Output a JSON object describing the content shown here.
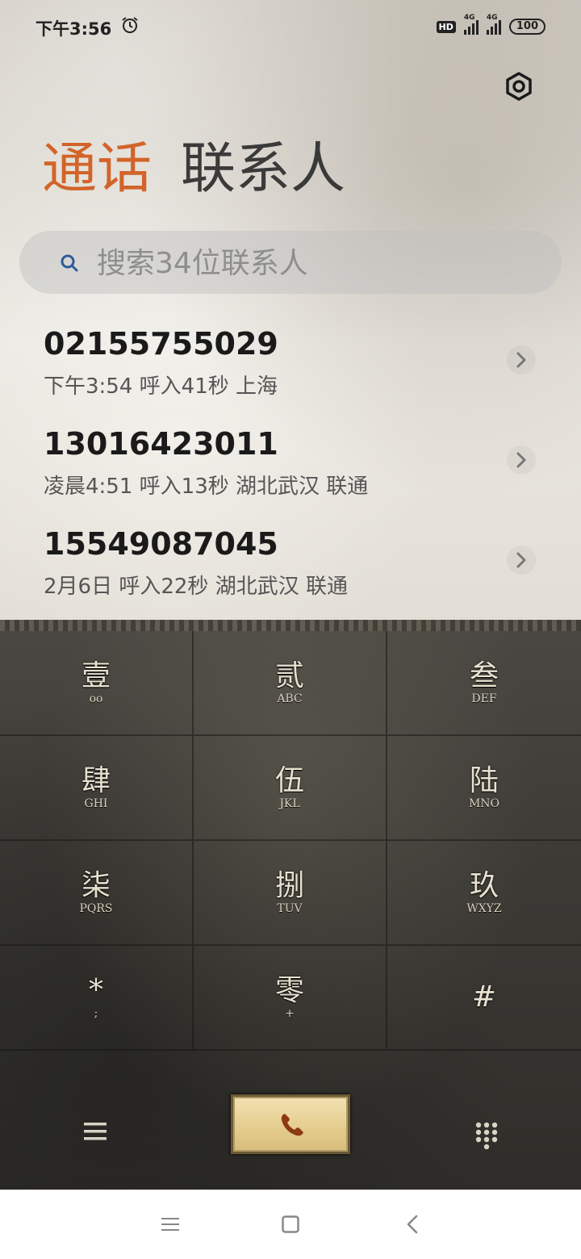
{
  "status_bar": {
    "time": "下午3:56",
    "hd": "HD",
    "sim1": "4G",
    "sim2": "4G",
    "battery": "100"
  },
  "tabs": [
    {
      "label": "通话",
      "active": true
    },
    {
      "label": "联系人",
      "active": false
    }
  ],
  "search": {
    "placeholder": "搜索34位联系人"
  },
  "calls": [
    {
      "number": "02155755029",
      "meta": "下午3:54 呼入41秒 上海"
    },
    {
      "number": "13016423011",
      "meta": "凌晨4:51 呼入13秒 湖北武汉 联通"
    },
    {
      "number": "15549087045",
      "meta": "2月6日 呼入22秒 湖北武汉 联通"
    }
  ],
  "keypad": [
    {
      "main": "壹",
      "sub": "oo"
    },
    {
      "main": "贰",
      "sub": "ABC"
    },
    {
      "main": "叁",
      "sub": "DEF"
    },
    {
      "main": "肆",
      "sub": "GHI"
    },
    {
      "main": "伍",
      "sub": "JKL"
    },
    {
      "main": "陆",
      "sub": "MNO"
    },
    {
      "main": "柒",
      "sub": "PQRS"
    },
    {
      "main": "捌",
      "sub": "TUV"
    },
    {
      "main": "玖",
      "sub": "WXYZ"
    },
    {
      "main": "*",
      "sub": ";"
    },
    {
      "main": "零",
      "sub": "+"
    },
    {
      "main": "#",
      "sub": ""
    }
  ],
  "colors": {
    "accent": "#d2642a",
    "tab_inactive": "#3a3a3a",
    "call_button": "#e6cf92"
  },
  "icons": {
    "settings": "settings-icon",
    "search": "search-icon",
    "chevron": "chevron-right-icon",
    "menu": "menu-icon",
    "call": "phone-icon",
    "dialpad": "dialpad-icon"
  }
}
